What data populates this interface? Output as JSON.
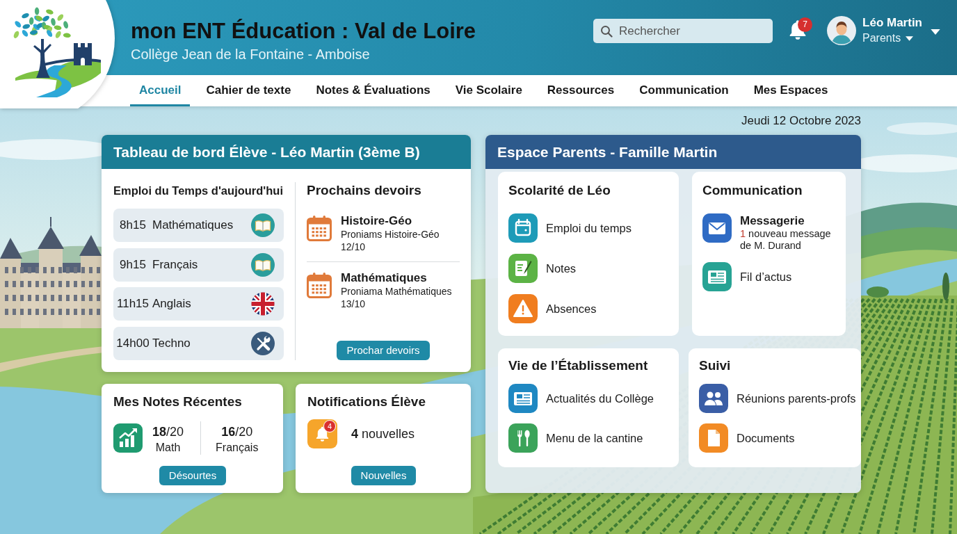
{
  "header": {
    "title": "mon ENT Éducation : Val de Loire",
    "subtitle": "Collège Jean de la Fontaine - Amboise",
    "search": {
      "placeholder": "Rechercher"
    },
    "notification_count": "7",
    "user": {
      "name": "Léo Martin",
      "role": "Parents"
    }
  },
  "nav": [
    {
      "label": "Accueil",
      "selected": true
    },
    {
      "label": "Cahier de texte",
      "selected": false
    },
    {
      "label": "Notes & Évaluations",
      "selected": false
    },
    {
      "label": "Vie Scolaire",
      "selected": false
    },
    {
      "label": "Ressources",
      "selected": false
    },
    {
      "label": "Communication",
      "selected": false
    },
    {
      "label": "Mes Espaces",
      "selected": false
    }
  ],
  "date": "Jeudi 12 Octobre 2023",
  "student_dashboard": {
    "title": "Tableau de bord Élève - Léo Martin (3ème B)",
    "schedule": {
      "title": "Emploi du Temps d'aujourd'hui",
      "items": [
        {
          "time": "8h15",
          "subject": "Mathématiques"
        },
        {
          "time": "9h15",
          "subject": "Français"
        },
        {
          "time": "11h15",
          "subject": "Anglais"
        },
        {
          "time": "14h00",
          "subject": "Techno"
        }
      ]
    },
    "homework": {
      "title": "Prochains devoirs",
      "items": [
        {
          "subject": "Histoire-Géo",
          "detail": "Proniams Histoire-Géo",
          "date": "12/10"
        },
        {
          "subject": "Mathématiques",
          "detail": "Proniama Mathématiques",
          "date": "13/10"
        }
      ],
      "button": "Prochar devoirs"
    }
  },
  "recent_grades": {
    "title": "Mes Notes Récentes",
    "grades": [
      {
        "score": "**18**/20",
        "subject": "Math"
      },
      {
        "score": "**16**/20",
        "subject": "Français"
      }
    ],
    "button": "Désourtes"
  },
  "student_notifications": {
    "title": "Notifications Élève",
    "badge": "4",
    "summary": "**4** nouvelles",
    "button": "Nouvelles"
  },
  "parent_space": {
    "title": "Espace Parents - Famille Martin",
    "sections": [
      {
        "title": "Scolarité de Léo",
        "items": [
          {
            "label": "Emploi du temps"
          },
          {
            "label": "Notes"
          },
          {
            "label": "Absences"
          }
        ]
      },
      {
        "title": "Communication",
        "items": [
          {
            "label": "Messagerie",
            "count": "1",
            "detail": "nouveau message de M. Durand"
          },
          {
            "label": "Fil d’actus"
          }
        ]
      },
      {
        "title": "Vie de l’Établissement",
        "items": [
          {
            "label": "Actualités du Collège"
          },
          {
            "label": "Menu de la cantine"
          }
        ]
      },
      {
        "title": "Suivi",
        "items": [
          {
            "label": "Réunions parents-profs"
          },
          {
            "label": "Documents"
          }
        ]
      }
    ]
  }
}
